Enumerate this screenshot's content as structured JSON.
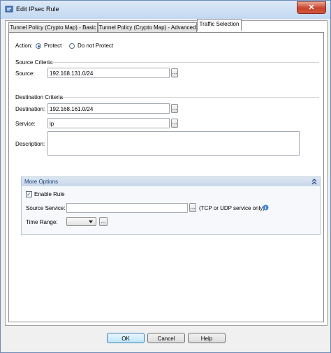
{
  "window": {
    "title": "Edit IPsec Rule",
    "close_glyph": "✕"
  },
  "tabs": [
    {
      "label": "Tunnel Policy (Crypto Map) - Basic"
    },
    {
      "label": "Tunnel Policy (Crypto Map) - Advanced"
    },
    {
      "label": "Traffic Selection"
    }
  ],
  "action": {
    "label": "Action:",
    "options": [
      "Protect",
      "Do not Protect"
    ],
    "selected": "Protect"
  },
  "source_criteria": {
    "heading": "Source Criteria",
    "source_label": "Source:",
    "source_value": "192.168.131.0/24"
  },
  "destination_criteria": {
    "heading": "Destination Criteria",
    "destination_label": "Destination:",
    "destination_value": "192.168.161.0/24",
    "service_label": "Service:",
    "service_value": "ip",
    "description_label": "Description:",
    "description_value": ""
  },
  "more_options": {
    "heading": "More Options",
    "enable_rule_label": "Enable Rule",
    "enable_rule_checked": true,
    "check_glyph": "✓",
    "source_service_label": "Source Service:",
    "source_service_value": "",
    "source_service_hint": "(TCP or UDP service only)",
    "time_range_label": "Time Range:",
    "time_range_value": ""
  },
  "ellipsis_glyph": "...",
  "buttons": {
    "ok": "OK",
    "cancel": "Cancel",
    "help": "Help"
  },
  "colors": {
    "accent": "#1f5fc2",
    "section_heading": "#1f3f7a",
    "title_bar": "#c3d8f1",
    "close_button": "#c8422b"
  }
}
